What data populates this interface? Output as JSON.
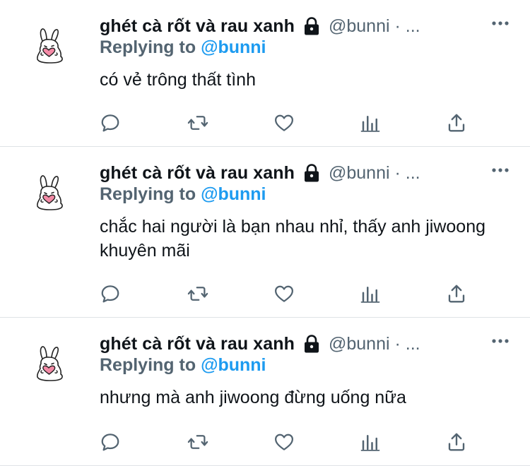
{
  "tweets": [
    {
      "display_name": "ghét cà rốt và rau xanh",
      "handle": "@bunni · ...",
      "replying_prefix": "Replying to ",
      "replying_to": "@bunni",
      "text": "có vẻ trông thất tình"
    },
    {
      "display_name": "ghét cà rốt và rau xanh",
      "handle": "@bunni · ...",
      "replying_prefix": "Replying to ",
      "replying_to": "@bunni",
      "text": "chắc hai người là bạn nhau nhỉ, thấy anh jiwoong khuyên mãi"
    },
    {
      "display_name": "ghét cà rốt và rau xanh",
      "handle": "@bunni · ...",
      "replying_prefix": "Replying to ",
      "replying_to": "@bunni",
      "text": "nhưng mà anh jiwoong đừng uống nữa"
    }
  ],
  "icons": {
    "avatar": "bunny-holding-heart",
    "lock": "lock-icon",
    "more": "more-dots-icon",
    "reply": "reply-bubble-icon",
    "retweet": "retweet-icon",
    "like": "heart-icon",
    "stats": "bar-chart-icon",
    "share": "share-upload-icon"
  },
  "colors": {
    "text": "#0f1419",
    "secondary": "#536471",
    "mention": "#1d9bf0",
    "divider": "#dfe3e6",
    "heart_pink": "#f48aa6"
  }
}
